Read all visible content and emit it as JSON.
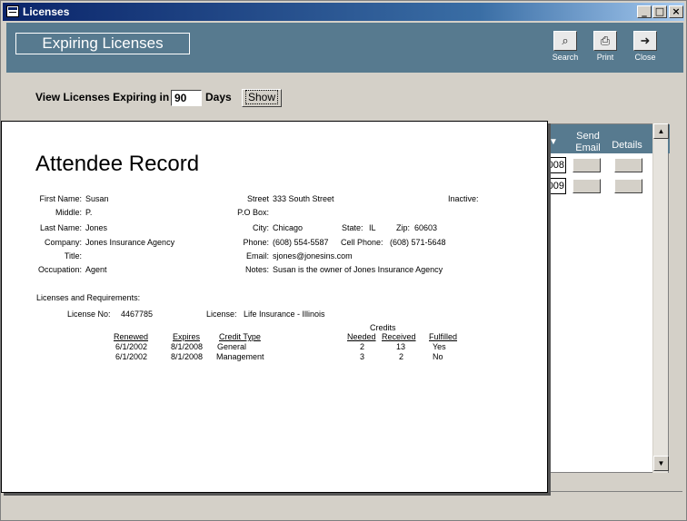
{
  "window": {
    "title": "Licenses"
  },
  "header": {
    "title": "Expiring Licenses",
    "buttons": [
      {
        "label": "Search",
        "icon": "binoculars-icon"
      },
      {
        "label": "Print",
        "icon": "printer-icon"
      },
      {
        "label": "Close",
        "icon": "exit-door-icon"
      }
    ],
    "color": "#577a8f"
  },
  "filter": {
    "label": "View Licenses Expiring in",
    "days_value": "90",
    "days_label": "Days",
    "show_label": "Show"
  },
  "grid": {
    "columns": {
      "send_email": "Send Email",
      "details": "Details"
    },
    "rows": [
      {
        "date": "008"
      },
      {
        "date": "009"
      }
    ]
  },
  "report": {
    "title": "Attendee Record",
    "fields": {
      "first_name": {
        "label": "First Name:",
        "value": "Susan"
      },
      "middle": {
        "label": "Middle:",
        "value": "P."
      },
      "last_name": {
        "label": "Last Name:",
        "value": "Jones"
      },
      "company": {
        "label": "Company:",
        "value": "Jones Insurance Agency"
      },
      "title": {
        "label": "Title:",
        "value": ""
      },
      "occupation": {
        "label": "Occupation:",
        "value": "Agent"
      },
      "street": {
        "label": "Street",
        "value": "333 South Street"
      },
      "po_box": {
        "label": "P.O Box:",
        "value": ""
      },
      "city": {
        "label": "City:",
        "value": "Chicago"
      },
      "state": {
        "label": "State:",
        "value": "IL"
      },
      "zip": {
        "label": "Zip:",
        "value": "60603"
      },
      "phone": {
        "label": "Phone:",
        "value": "(608) 554-5587"
      },
      "cell_phone": {
        "label": "Cell Phone:",
        "value": "(608) 571-5648"
      },
      "email": {
        "label": "Email:",
        "value": "sjones@jonesins.com"
      },
      "notes": {
        "label": "Notes:",
        "value": "Susan is the owner of Jones Insurance Agency"
      },
      "inactive": {
        "label": "Inactive:",
        "value": ""
      }
    },
    "licenses": {
      "section_label": "Licenses and Requirements:",
      "license_no_label": "License No:",
      "license_no": "4467785",
      "license_label": "License:",
      "license": "Life Insurance - Illinois",
      "credits_label": "Credits",
      "headers": {
        "renewed": "Renewed",
        "expires": "Expires",
        "credit_type": "Credit Type",
        "needed": "Needed",
        "received": "Received",
        "fulfilled": "Fulfilled"
      },
      "rows": [
        {
          "renewed": "6/1/2002",
          "expires": "8/1/2008",
          "credit_type": "General",
          "needed": "2",
          "received": "13",
          "fulfilled": "Yes"
        },
        {
          "renewed": "6/1/2002",
          "expires": "8/1/2008",
          "credit_type": "Management",
          "needed": "3",
          "received": "2",
          "fulfilled": "No"
        }
      ]
    }
  }
}
